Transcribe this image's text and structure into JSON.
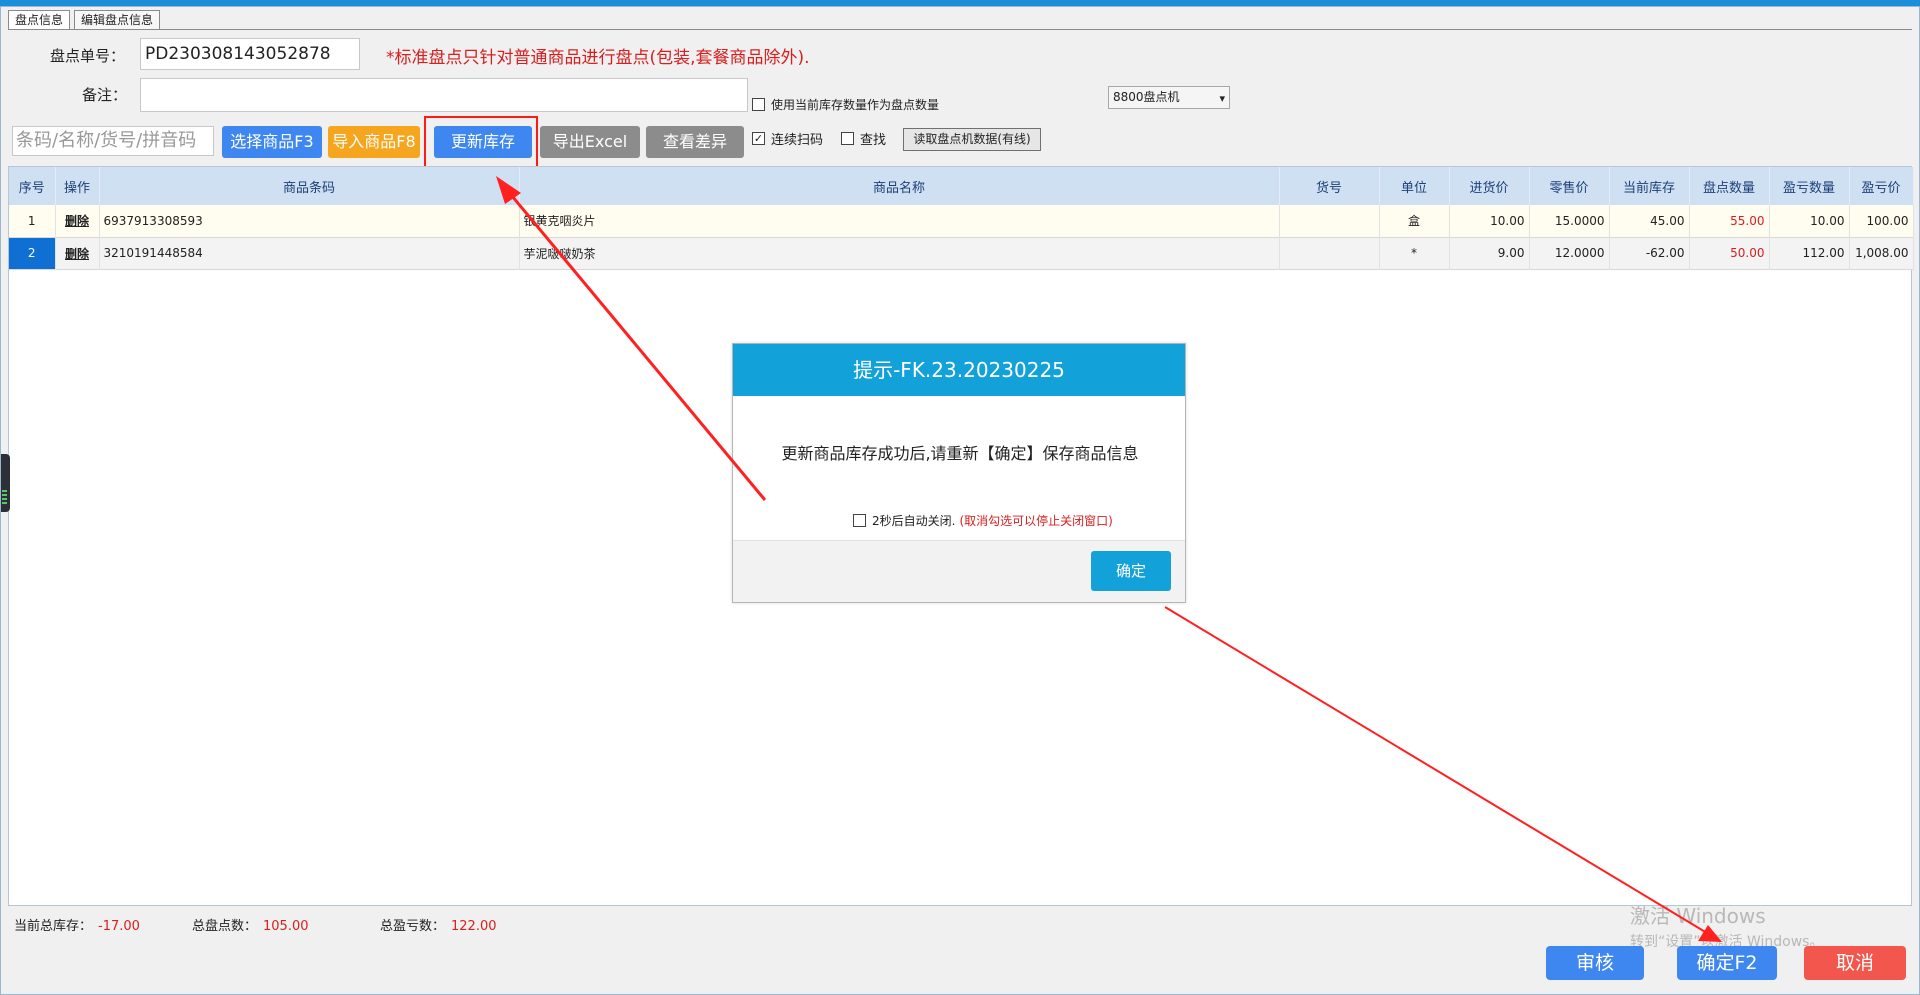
{
  "tabs": [
    "盘点信息",
    "编辑盘点信息"
  ],
  "form": {
    "order_label": "盘点单号：",
    "order_value": "PD230308143052878",
    "notice": "*标准盘点只针对普通商品进行盘点(包装,套餐商品除外).",
    "remark_label": "备注：",
    "remark_value": "",
    "use_stock_label": "使用当前库存数量作为盘点数量",
    "device_select": "8800盘点机"
  },
  "toolbar": {
    "search_placeholder": "条码/名称/货号/拼音码",
    "select_goods": "选择商品F3",
    "import_goods": "导入商品F8",
    "update_stock": "更新库存",
    "export_excel": "导出Excel",
    "view_diff": "查看差异",
    "continuous_scan": "连续扫码",
    "continuous_scan_checked": true,
    "find": "查找",
    "find_checked": false,
    "read_device": "读取盘点机数据(有线)"
  },
  "table": {
    "headers": [
      "序号",
      "操作",
      "商品条码",
      "商品名称",
      "货号",
      "单位",
      "进货价",
      "零售价",
      "当前库存",
      "盘点数量",
      "盈亏数量",
      "盈亏价"
    ],
    "rows": [
      {
        "seq": "1",
        "op": "删除",
        "barcode": "6937913308593",
        "name": "银黄克咽炎片",
        "sku": "",
        "unit": "盒",
        "cost": "10.00",
        "price": "15.0000",
        "stock": "45.00",
        "count": "55.00",
        "diff_qty": "10.00",
        "diff_amt": "100.00"
      },
      {
        "seq": "2",
        "op": "删除",
        "barcode": "3210191448584",
        "name": "芋泥啵啵奶茶",
        "sku": "",
        "unit": "*",
        "cost": "9.00",
        "price": "12.0000",
        "stock": "-62.00",
        "count": "50.00",
        "diff_qty": "112.00",
        "diff_amt": "1,008.00"
      }
    ]
  },
  "footer": {
    "total_stock_label": "当前总库存：",
    "total_stock": "-17.00",
    "total_count_label": "总盘点数：",
    "total_count": "105.00",
    "total_diff_label": "总盈亏数：",
    "total_diff": "122.00",
    "approve": "审核",
    "confirm": "确定F2",
    "cancel": "取消"
  },
  "watermark": {
    "line1": "激活 Windows",
    "line2": "转到“设置”以激活 Windows。"
  },
  "dialog": {
    "title": "提示-FK.23.20230225",
    "message": "更新商品库存成功后,请重新【确定】保存商品信息",
    "auto_close": "2秒后自动关闭.",
    "auto_close_hint": "(取消勾选可以停止关闭窗口)",
    "ok": "确定"
  },
  "colors": {
    "accent_blue": "#3e86f0",
    "dialog_blue": "#12a1d8",
    "warning_red": "#d81e1e",
    "orange": "#f6a51e",
    "cancel_red": "#f3564d"
  }
}
